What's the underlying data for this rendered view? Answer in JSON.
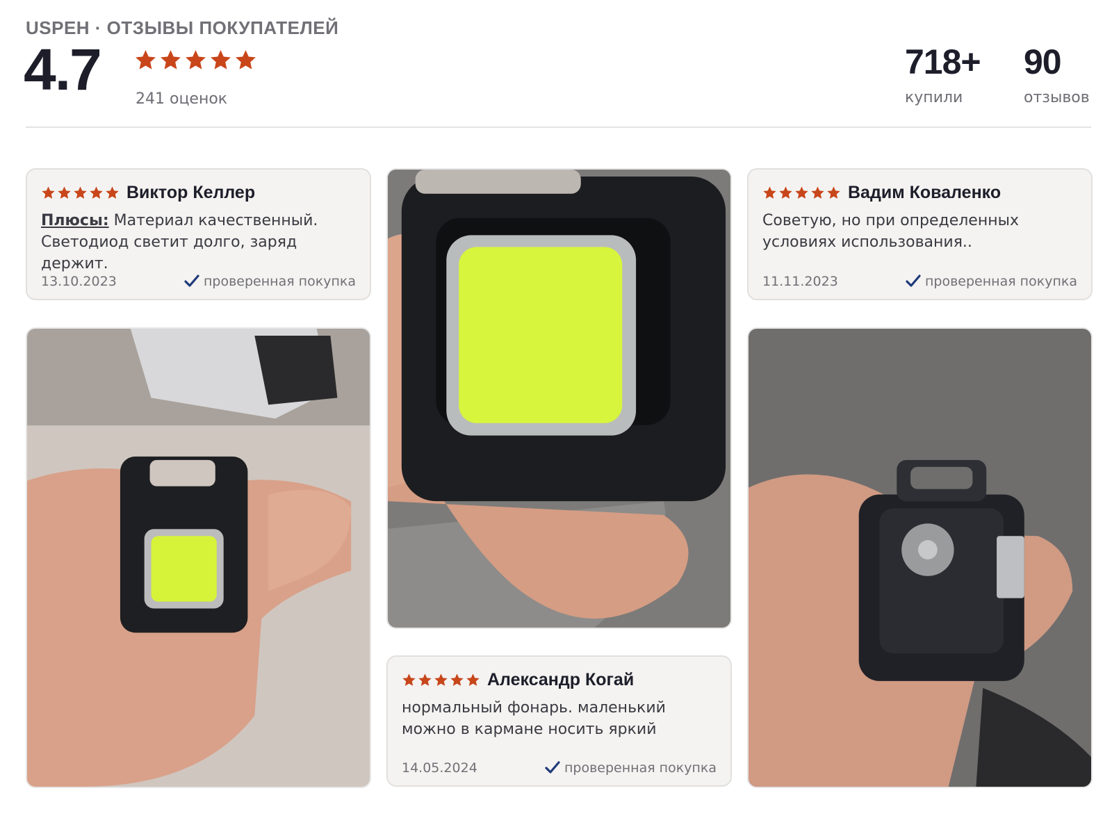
{
  "header": {
    "brand": "USPEH · ОТЗЫВЫ ПОКУПАТЕЛЕЙ",
    "score": "4.7",
    "rating_count": "241 оценок",
    "stars_filled": 5,
    "bought_value": "718+",
    "bought_label": "купили",
    "reviews_value": "90",
    "reviews_label": "отзывов"
  },
  "colors": {
    "star": "#c8461a",
    "check": "#1f3a7a",
    "card_bg": "#f4f3f1"
  },
  "reviews": [
    {
      "author": "Виктор Келлер",
      "pros_label": "Плюсы:",
      "text": "Материал качественный. Светодиод светит долго, заряд держит.",
      "date": "13.10.2023",
      "verified": "проверенная покупка"
    },
    {
      "author": "Вадим Коваленко",
      "text": "Советую, но при определенных условиях использования..",
      "date": "11.11.2023",
      "verified": "проверенная покупка"
    },
    {
      "author": "Александр Когай",
      "text": "нормальный фонарь. маленький можно в кармане носить яркий",
      "date": "14.05.2024",
      "verified": "проверенная покупка"
    }
  ]
}
